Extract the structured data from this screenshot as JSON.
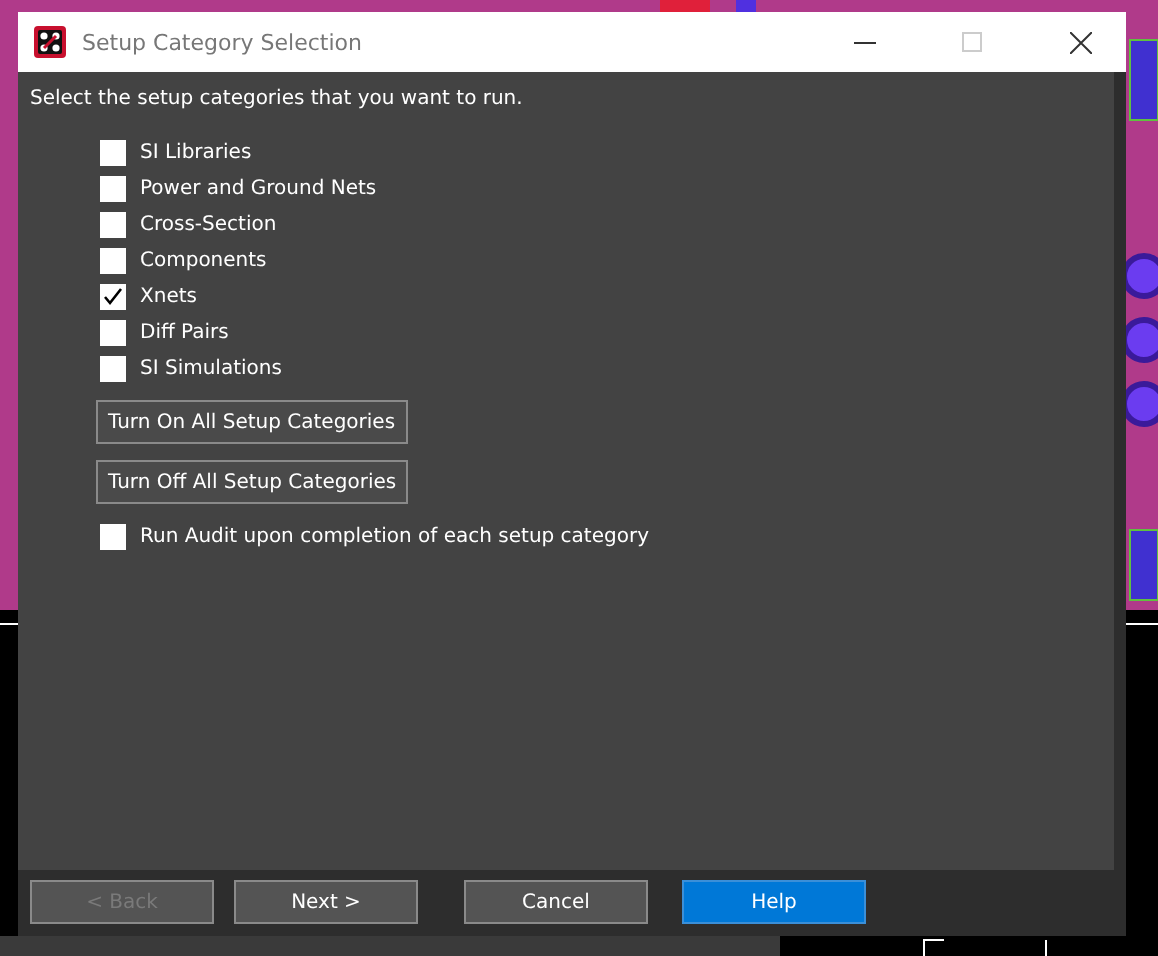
{
  "window": {
    "title": "Setup Category Selection"
  },
  "instruction": "Select the setup categories that you want to run.",
  "categories": [
    {
      "label": "SI Libraries",
      "checked": false
    },
    {
      "label": "Power and Ground Nets",
      "checked": false
    },
    {
      "label": "Cross-Section",
      "checked": false
    },
    {
      "label": "Components",
      "checked": false
    },
    {
      "label": "Xnets",
      "checked": true
    },
    {
      "label": "Diff Pairs",
      "checked": false
    },
    {
      "label": "SI Simulations",
      "checked": false
    }
  ],
  "actions": [
    "Turn On All Setup Categories",
    "Turn Off All Setup Categories"
  ],
  "audit": {
    "label": "Run Audit upon completion of each setup category",
    "checked": false
  },
  "footer_buttons": [
    {
      "label": "< Back",
      "disabled": true,
      "default": false
    },
    {
      "label": "Next >",
      "disabled": false,
      "default": false
    },
    {
      "label": "Cancel",
      "disabled": false,
      "default": false
    },
    {
      "label": "Help",
      "disabled": false,
      "default": true
    }
  ]
}
